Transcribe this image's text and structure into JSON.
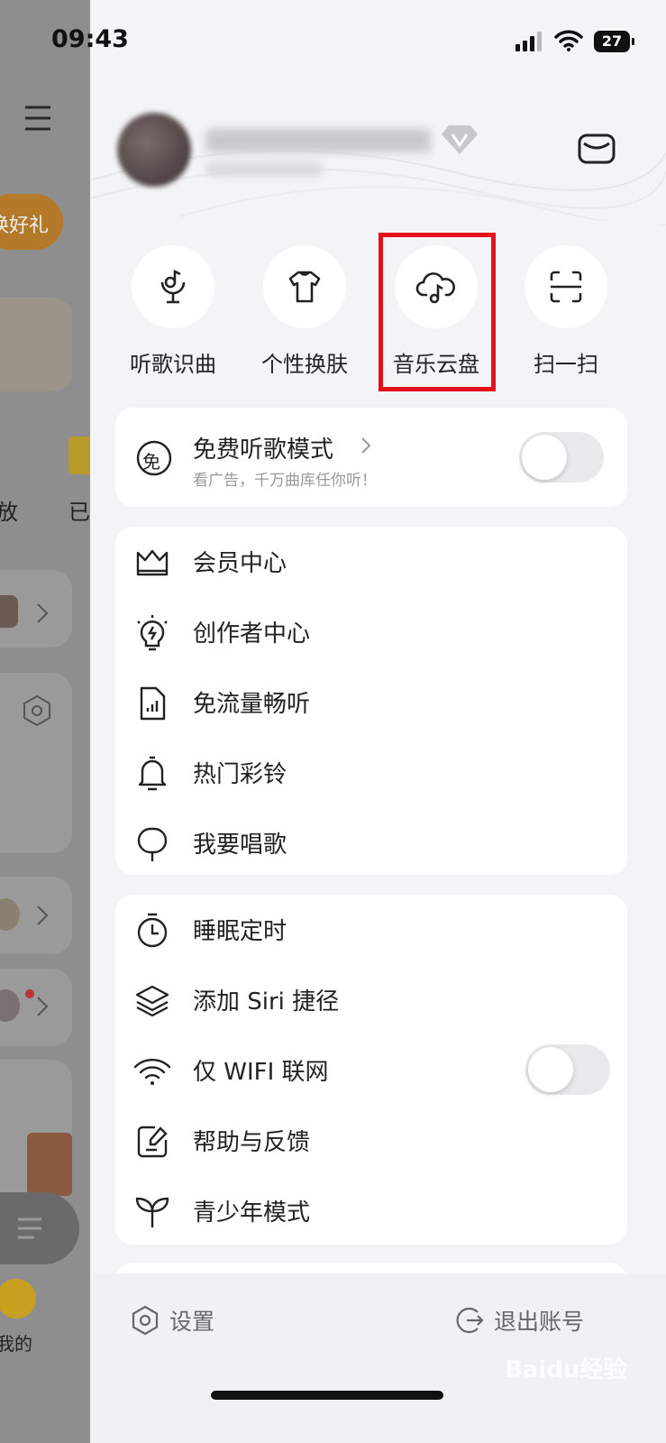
{
  "status_bar": {
    "time": "09:43",
    "battery": "27"
  },
  "background_app": {
    "promo_text": "换好礼",
    "partial_labels": [
      "放",
      "已"
    ],
    "tab_label": "我的"
  },
  "drawer": {
    "shortcuts": [
      {
        "label": "听歌识曲",
        "icon": "song-recognition-icon"
      },
      {
        "label": "个性换肤",
        "icon": "tshirt-icon"
      },
      {
        "label": "音乐云盘",
        "icon": "cloud-music-icon"
      },
      {
        "label": "扫一扫",
        "icon": "scan-icon"
      }
    ],
    "free_mode": {
      "title": "免费听歌模式",
      "subtitle": "看广告，千万曲库任你听！",
      "icon_text": "免",
      "toggle_on": false
    },
    "menu_group_1": [
      {
        "label": "会员中心",
        "icon": "crown-icon"
      },
      {
        "label": "创作者中心",
        "icon": "lightbulb-icon"
      },
      {
        "label": "免流量畅听",
        "icon": "data-sim-icon"
      },
      {
        "label": "热门彩铃",
        "icon": "bell-icon"
      },
      {
        "label": "我要唱歌",
        "icon": "microphone-icon"
      }
    ],
    "menu_group_2": [
      {
        "label": "睡眠定时",
        "icon": "timer-icon"
      },
      {
        "label": "添加 Siri 捷径",
        "icon": "layers-icon"
      },
      {
        "label": "仅 WIFI 联网",
        "icon": "wifi-icon",
        "toggle_on": false
      },
      {
        "label": "帮助与反馈",
        "icon": "feedback-icon"
      },
      {
        "label": "青少年模式",
        "icon": "sprout-icon"
      }
    ],
    "bottom": {
      "settings": "设置",
      "logout": "退出账号"
    }
  },
  "watermark": "Baidu经验",
  "colors": {
    "highlight": "#e5101c",
    "accent": "#f0a020"
  }
}
